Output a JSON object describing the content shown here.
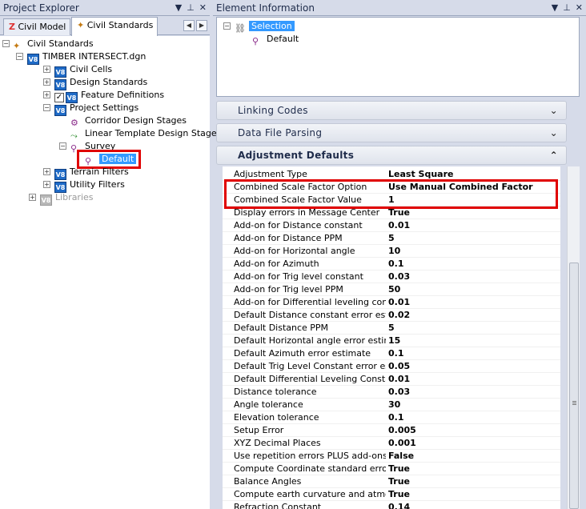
{
  "project_explorer": {
    "title": "Project Explorer",
    "tabs": [
      {
        "label": "Civil Model"
      },
      {
        "label": "Civil Standards"
      }
    ],
    "tree": {
      "root": "Civil Standards",
      "file": "TIMBER INTERSECT.dgn",
      "civil_cells": "Civil Cells",
      "design_standards": "Design Standards",
      "feature_definitions": "Feature Definitions",
      "project_settings": "Project Settings",
      "corridor_design_stages": "Corridor Design Stages",
      "linear_template_design_stages": "Linear Template Design Stages",
      "survey": "Survey",
      "default": "Default",
      "terrain_filters": "Terrain Filters",
      "utility_filters": "Utility Filters",
      "libraries": "Libraries"
    },
    "v8": "V8"
  },
  "element_information": {
    "title": "Element Information",
    "selection": "Selection",
    "selection_child": "Default",
    "sections": {
      "linking_codes": "Linking Codes",
      "data_file_parsing": "Data File Parsing",
      "adjustment_defaults": "Adjustment Defaults"
    },
    "properties": [
      {
        "name": "Adjustment Type",
        "value": "Least Square"
      },
      {
        "name": "Combined Scale Factor Option",
        "value": "Use Manual Combined Factor"
      },
      {
        "name": "Combined Scale Factor Value",
        "value": "1"
      },
      {
        "name": "Display errors in Message Center",
        "value": "True"
      },
      {
        "name": "Add-on for Distance constant",
        "value": "0.01"
      },
      {
        "name": "Add-on for Distance PPM",
        "value": "5"
      },
      {
        "name": "Add-on for Horizontal angle",
        "value": "10"
      },
      {
        "name": "Add-on for Azimuth",
        "value": "0.1"
      },
      {
        "name": "Add-on for Trig level constant",
        "value": "0.03"
      },
      {
        "name": "Add-on for Trig level PPM",
        "value": "50"
      },
      {
        "name": "Add-on for Differential leveling consta",
        "value": "0.01"
      },
      {
        "name": "Default Distance constant error estima",
        "value": "0.02"
      },
      {
        "name": "Default Distance PPM",
        "value": "5"
      },
      {
        "name": "Default Horizontal angle error estimate",
        "value": "15"
      },
      {
        "name": "Default Azimuth error estimate",
        "value": "0.1"
      },
      {
        "name": "Default Trig Level Constant error estin",
        "value": "0.05"
      },
      {
        "name": "Default Differential Leveling Constant",
        "value": "0.01"
      },
      {
        "name": "Distance tolerance",
        "value": "0.03"
      },
      {
        "name": "Angle tolerance",
        "value": "30"
      },
      {
        "name": "Elevation tolerance",
        "value": "0.1"
      },
      {
        "name": "Setup Error",
        "value": "0.005"
      },
      {
        "name": "XYZ Decimal Places",
        "value": "0.001"
      },
      {
        "name": "Use repetition errors PLUS add-ons fc",
        "value": "False"
      },
      {
        "name": "Compute Coordinate standard error ar",
        "value": "True"
      },
      {
        "name": "Balance Angles",
        "value": "True"
      },
      {
        "name": "Compute earth curvature and atmosph",
        "value": "True"
      },
      {
        "name": "Refraction Constant",
        "value": "0.14"
      }
    ]
  },
  "controls": {
    "dropdown": "▼",
    "pin": "⊥",
    "close": "✕",
    "nav_left": "◀",
    "nav_right": "▶",
    "expand": "⌄",
    "collapse": "⌃"
  },
  "colors": {
    "highlight": "#e00000",
    "selection": "#3399ff",
    "v8_blue": "#1f6bc7"
  }
}
